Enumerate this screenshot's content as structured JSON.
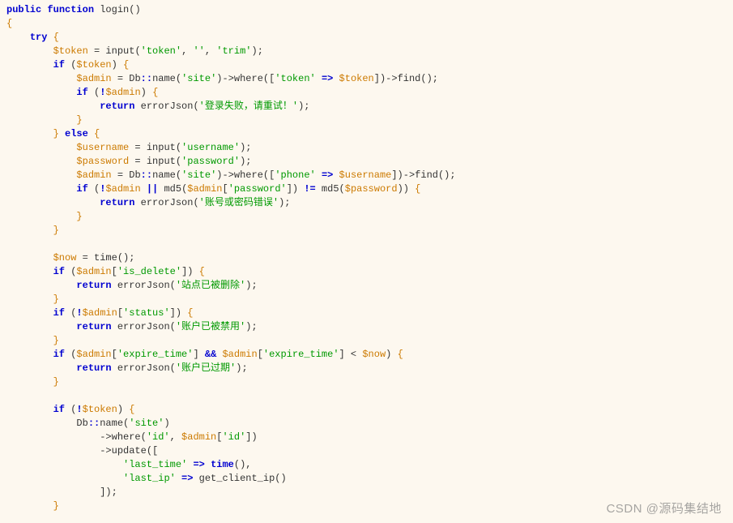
{
  "lines": [
    [
      [
        "kw",
        "public"
      ],
      [
        "plain",
        " "
      ],
      [
        "kw",
        "function"
      ],
      [
        "plain",
        " login()"
      ]
    ],
    [
      [
        "brace",
        "{"
      ]
    ],
    [
      [
        "plain",
        "    "
      ],
      [
        "kw2",
        "try"
      ],
      [
        "plain",
        " "
      ],
      [
        "brace",
        "{"
      ]
    ],
    [
      [
        "plain",
        "        "
      ],
      [
        "var",
        "$token"
      ],
      [
        "plain",
        " = input("
      ],
      [
        "str",
        "'token'"
      ],
      [
        "plain",
        ", "
      ],
      [
        "str",
        "''"
      ],
      [
        "plain",
        ", "
      ],
      [
        "str",
        "'trim'"
      ],
      [
        "plain",
        ");"
      ]
    ],
    [
      [
        "plain",
        "        "
      ],
      [
        "kw2",
        "if"
      ],
      [
        "plain",
        " ("
      ],
      [
        "var",
        "$token"
      ],
      [
        "plain",
        ") "
      ],
      [
        "brace",
        "{"
      ]
    ],
    [
      [
        "plain",
        "            "
      ],
      [
        "var",
        "$admin"
      ],
      [
        "plain",
        " = Db"
      ],
      [
        "dcolon",
        "::"
      ],
      [
        "plain",
        "name("
      ],
      [
        "str",
        "'site'"
      ],
      [
        "plain",
        ")->where(["
      ],
      [
        "str",
        "'token'"
      ],
      [
        "plain",
        " "
      ],
      [
        "arrow",
        "=>"
      ],
      [
        "plain",
        " "
      ],
      [
        "var",
        "$token"
      ],
      [
        "plain",
        "])->find();"
      ]
    ],
    [
      [
        "plain",
        "            "
      ],
      [
        "kw2",
        "if"
      ],
      [
        "plain",
        " ("
      ],
      [
        "op",
        "!"
      ],
      [
        "var",
        "$admin"
      ],
      [
        "plain",
        ") "
      ],
      [
        "brace",
        "{"
      ]
    ],
    [
      [
        "plain",
        "                "
      ],
      [
        "kw",
        "return"
      ],
      [
        "plain",
        " errorJson("
      ],
      [
        "str",
        "'登录失败，请重试！'"
      ],
      [
        "plain",
        ");"
      ]
    ],
    [
      [
        "plain",
        "            "
      ],
      [
        "brace",
        "}"
      ]
    ],
    [
      [
        "plain",
        "        "
      ],
      [
        "brace",
        "}"
      ],
      [
        "plain",
        " "
      ],
      [
        "kw2",
        "else"
      ],
      [
        "plain",
        " "
      ],
      [
        "brace",
        "{"
      ]
    ],
    [
      [
        "plain",
        "            "
      ],
      [
        "var",
        "$username"
      ],
      [
        "plain",
        " = input("
      ],
      [
        "str",
        "'username'"
      ],
      [
        "plain",
        ");"
      ]
    ],
    [
      [
        "plain",
        "            "
      ],
      [
        "var",
        "$password"
      ],
      [
        "plain",
        " = input("
      ],
      [
        "str",
        "'password'"
      ],
      [
        "plain",
        ");"
      ]
    ],
    [
      [
        "plain",
        "            "
      ],
      [
        "var",
        "$admin"
      ],
      [
        "plain",
        " = Db"
      ],
      [
        "dcolon",
        "::"
      ],
      [
        "plain",
        "name("
      ],
      [
        "str",
        "'site'"
      ],
      [
        "plain",
        ")->where(["
      ],
      [
        "str",
        "'phone'"
      ],
      [
        "plain",
        " "
      ],
      [
        "arrow",
        "=>"
      ],
      [
        "plain",
        " "
      ],
      [
        "var",
        "$username"
      ],
      [
        "plain",
        "])->find();"
      ]
    ],
    [
      [
        "plain",
        "            "
      ],
      [
        "kw2",
        "if"
      ],
      [
        "plain",
        " ("
      ],
      [
        "op",
        "!"
      ],
      [
        "var",
        "$admin"
      ],
      [
        "plain",
        " "
      ],
      [
        "op",
        "||"
      ],
      [
        "plain",
        " md5("
      ],
      [
        "var",
        "$admin"
      ],
      [
        "plain",
        "["
      ],
      [
        "str",
        "'password'"
      ],
      [
        "plain",
        "]) "
      ],
      [
        "op",
        "!="
      ],
      [
        "plain",
        " md5("
      ],
      [
        "var",
        "$password"
      ],
      [
        "plain",
        ")) "
      ],
      [
        "brace",
        "{"
      ]
    ],
    [
      [
        "plain",
        "                "
      ],
      [
        "kw",
        "return"
      ],
      [
        "plain",
        " errorJson("
      ],
      [
        "str",
        "'账号或密码错误'"
      ],
      [
        "plain",
        ");"
      ]
    ],
    [
      [
        "plain",
        "            "
      ],
      [
        "brace",
        "}"
      ]
    ],
    [
      [
        "plain",
        "        "
      ],
      [
        "brace",
        "}"
      ]
    ],
    [
      [
        "plain",
        ""
      ]
    ],
    [
      [
        "plain",
        "        "
      ],
      [
        "var",
        "$now"
      ],
      [
        "plain",
        " = time();"
      ]
    ],
    [
      [
        "plain",
        "        "
      ],
      [
        "kw2",
        "if"
      ],
      [
        "plain",
        " ("
      ],
      [
        "var",
        "$admin"
      ],
      [
        "plain",
        "["
      ],
      [
        "str",
        "'is_delete'"
      ],
      [
        "plain",
        "]) "
      ],
      [
        "brace",
        "{"
      ]
    ],
    [
      [
        "plain",
        "            "
      ],
      [
        "kw",
        "return"
      ],
      [
        "plain",
        " errorJson("
      ],
      [
        "str",
        "'站点已被删除'"
      ],
      [
        "plain",
        ");"
      ]
    ],
    [
      [
        "plain",
        "        "
      ],
      [
        "brace",
        "}"
      ]
    ],
    [
      [
        "plain",
        "        "
      ],
      [
        "kw2",
        "if"
      ],
      [
        "plain",
        " ("
      ],
      [
        "op",
        "!"
      ],
      [
        "var",
        "$admin"
      ],
      [
        "plain",
        "["
      ],
      [
        "str",
        "'status'"
      ],
      [
        "plain",
        "]) "
      ],
      [
        "brace",
        "{"
      ]
    ],
    [
      [
        "plain",
        "            "
      ],
      [
        "kw",
        "return"
      ],
      [
        "plain",
        " errorJson("
      ],
      [
        "str",
        "'账户已被禁用'"
      ],
      [
        "plain",
        ");"
      ]
    ],
    [
      [
        "plain",
        "        "
      ],
      [
        "brace",
        "}"
      ]
    ],
    [
      [
        "plain",
        "        "
      ],
      [
        "kw2",
        "if"
      ],
      [
        "plain",
        " ("
      ],
      [
        "var",
        "$admin"
      ],
      [
        "plain",
        "["
      ],
      [
        "str",
        "'expire_time'"
      ],
      [
        "plain",
        "] "
      ],
      [
        "op",
        "&&"
      ],
      [
        "plain",
        " "
      ],
      [
        "var",
        "$admin"
      ],
      [
        "plain",
        "["
      ],
      [
        "str",
        "'expire_time'"
      ],
      [
        "plain",
        "] < "
      ],
      [
        "var",
        "$now"
      ],
      [
        "plain",
        ") "
      ],
      [
        "brace",
        "{"
      ]
    ],
    [
      [
        "plain",
        "            "
      ],
      [
        "kw",
        "return"
      ],
      [
        "plain",
        " errorJson("
      ],
      [
        "str",
        "'账户已过期'"
      ],
      [
        "plain",
        ");"
      ]
    ],
    [
      [
        "plain",
        "        "
      ],
      [
        "brace",
        "}"
      ]
    ],
    [
      [
        "plain",
        ""
      ]
    ],
    [
      [
        "plain",
        "        "
      ],
      [
        "kw2",
        "if"
      ],
      [
        "plain",
        " ("
      ],
      [
        "op",
        "!"
      ],
      [
        "var",
        "$token"
      ],
      [
        "plain",
        ") "
      ],
      [
        "brace",
        "{"
      ]
    ],
    [
      [
        "plain",
        "            Db"
      ],
      [
        "dcolon",
        "::"
      ],
      [
        "plain",
        "name("
      ],
      [
        "str",
        "'site'"
      ],
      [
        "plain",
        ")"
      ]
    ],
    [
      [
        "plain",
        "                ->where("
      ],
      [
        "str",
        "'id'"
      ],
      [
        "plain",
        ", "
      ],
      [
        "var",
        "$admin"
      ],
      [
        "plain",
        "["
      ],
      [
        "str",
        "'id'"
      ],
      [
        "plain",
        "])"
      ]
    ],
    [
      [
        "plain",
        "                ->update(["
      ]
    ],
    [
      [
        "plain",
        "                    "
      ],
      [
        "str",
        "'last_time'"
      ],
      [
        "plain",
        " "
      ],
      [
        "arrow",
        "=>"
      ],
      [
        "plain",
        " "
      ],
      [
        "kw",
        "time"
      ],
      [
        "plain",
        "(),"
      ]
    ],
    [
      [
        "plain",
        "                    "
      ],
      [
        "str",
        "'last_ip'"
      ],
      [
        "plain",
        " "
      ],
      [
        "arrow",
        "=>"
      ],
      [
        "plain",
        " get_client_ip()"
      ]
    ],
    [
      [
        "plain",
        "                ]);"
      ]
    ],
    [
      [
        "plain",
        "        "
      ],
      [
        "brace",
        "}"
      ]
    ]
  ],
  "watermark": "CSDN @源码集结地"
}
